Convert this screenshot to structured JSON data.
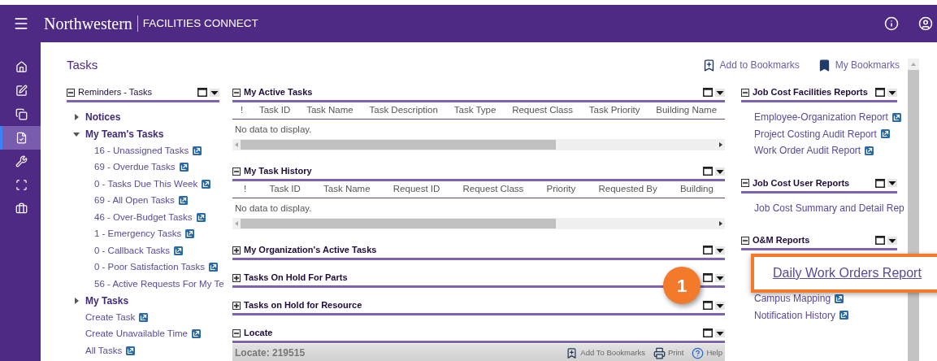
{
  "header": {
    "brand": "Northwestern",
    "product": "FACILITIES CONNECT"
  },
  "rail": [
    {
      "selected": false
    },
    {
      "selected": false
    },
    {
      "selected": false
    },
    {
      "selected": true
    },
    {
      "selected": false
    },
    {
      "selected": false
    },
    {
      "selected": false
    }
  ],
  "page_title": "Tasks",
  "page_actions": [
    "Add to Bookmarks",
    "My Bookmarks"
  ],
  "left_panel": {
    "title": "Reminders - Tasks",
    "expanded": true,
    "items": [
      {
        "kind": "node",
        "label": "Notices",
        "expanded": false
      },
      {
        "kind": "node",
        "label": "My Team's Tasks",
        "expanded": true,
        "children": [
          {
            "kind": "link",
            "label": "16 - Unassigned Tasks"
          },
          {
            "kind": "link",
            "label": "69 - Overdue Tasks"
          },
          {
            "kind": "link",
            "label": "0 - Tasks Due This Week"
          },
          {
            "kind": "link",
            "label": "69 - All Open Tasks"
          },
          {
            "kind": "link",
            "label": "46 - Over-Budget Tasks"
          },
          {
            "kind": "link",
            "label": "1 - Emergency Tasks"
          },
          {
            "kind": "link",
            "label": "0 - Callback Tasks"
          },
          {
            "kind": "link",
            "label": "0 - Poor Satisfaction Tasks"
          },
          {
            "kind": "text",
            "label": "56 - Active Requests For My Te"
          }
        ]
      },
      {
        "kind": "node",
        "label": "My Tasks",
        "expanded": false
      },
      {
        "kind": "link",
        "label": "Create Task"
      },
      {
        "kind": "link",
        "label": "Create Unavailable Time"
      },
      {
        "kind": "link",
        "label": "All Tasks"
      }
    ]
  },
  "middle_panels": [
    {
      "kind": "table",
      "title": "My Active Tasks",
      "expanded": true,
      "columns": [
        "!",
        "Task ID",
        "Task Name",
        "Task Description",
        "Task Type",
        "Request Class",
        "Task Priority",
        "Building Name"
      ],
      "empty_text": "No data to display."
    },
    {
      "kind": "table",
      "title": "My Task History",
      "expanded": true,
      "columns": [
        "!",
        "Task ID",
        "Task Name",
        "Request ID",
        "Request Class",
        "Priority",
        "Requested By",
        "Building"
      ],
      "empty_text": "No data to display."
    },
    {
      "kind": "table",
      "title": "My Organization's Active Tasks",
      "expanded": false
    },
    {
      "kind": "table",
      "title": "Tasks On Hold For Parts",
      "expanded": false
    },
    {
      "kind": "table",
      "title": "Tasks on Hold for Resource",
      "expanded": false
    },
    {
      "kind": "locate",
      "title": "Locate",
      "expanded": true,
      "locate_label": "Locate: 219515",
      "actions": [
        "Add To Bookmarks",
        "Print",
        "Help"
      ]
    }
  ],
  "right_panels": [
    {
      "title": "Job Cost Facilities Reports",
      "expanded": true,
      "links": [
        {
          "kind": "link",
          "label": "Employee-Organization Report"
        },
        {
          "kind": "link",
          "label": "Project Costing Audit Report"
        },
        {
          "kind": "link",
          "label": "Work Order Audit Report"
        }
      ]
    },
    {
      "title": "Job Cost User Reports",
      "expanded": true,
      "links": [
        {
          "kind": "text",
          "label": "Job Cost Summary and Detail Rep"
        }
      ]
    },
    {
      "title": "O&M Reports",
      "expanded": true,
      "links": [
        {
          "kind": "callout",
          "number": "1",
          "label": "Daily Work Orders Report"
        },
        {
          "kind": "link",
          "label": "Campus Mapping"
        },
        {
          "kind": "link",
          "label": "Notification History"
        }
      ]
    }
  ]
}
